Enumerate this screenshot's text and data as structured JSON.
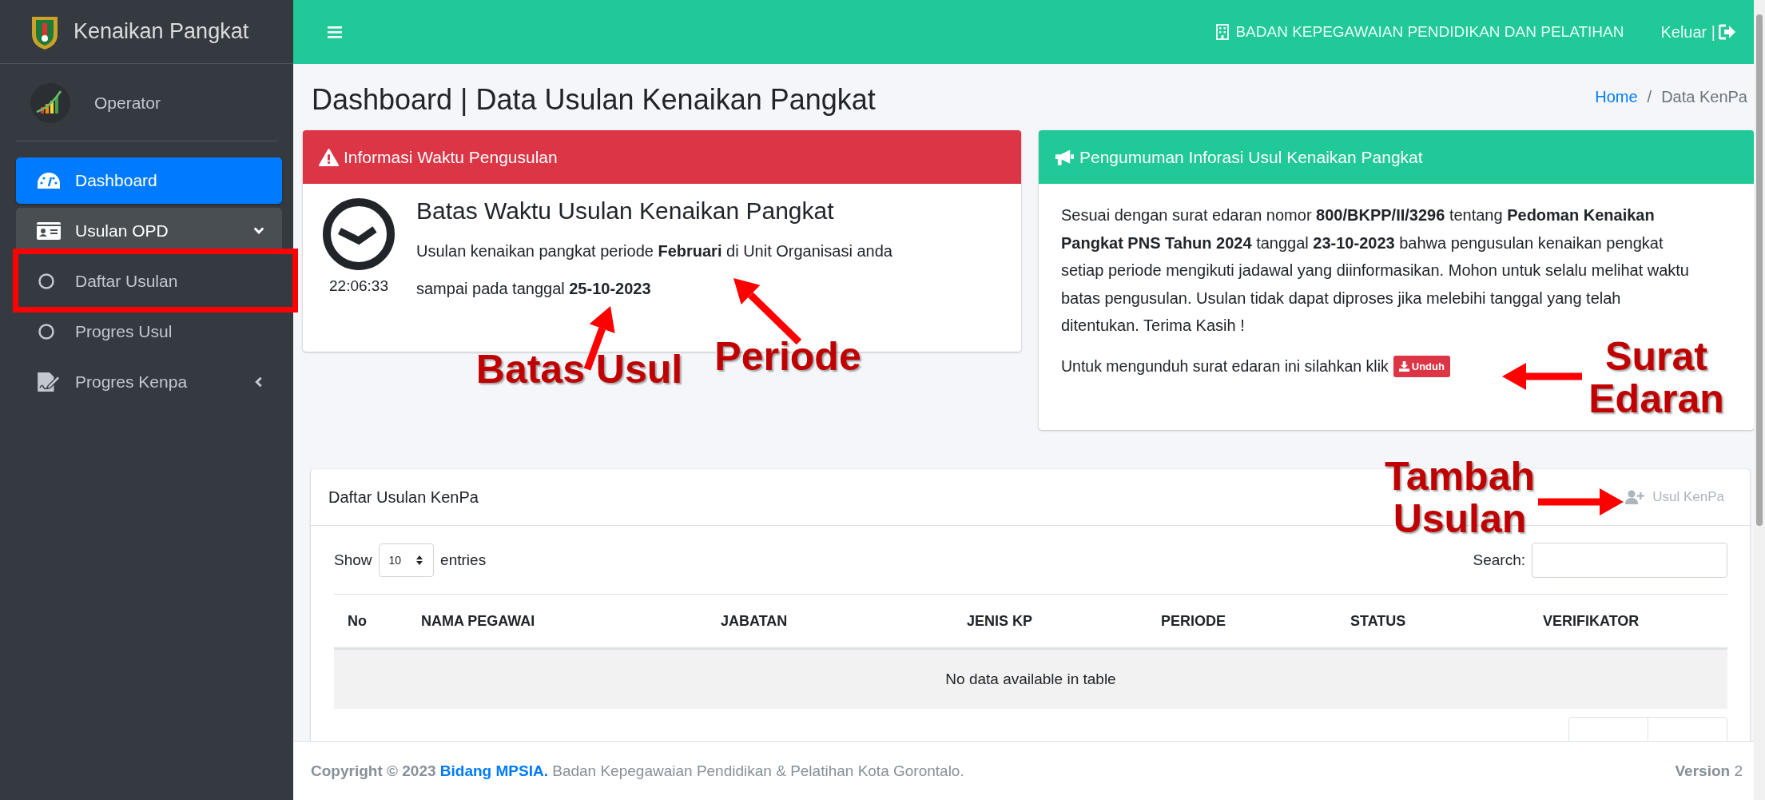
{
  "sidebar": {
    "brand": "Kenaikan Pangkat",
    "user": "Operator",
    "items": [
      {
        "label": "Dashboard",
        "selected": true
      },
      {
        "label": "Usulan OPD",
        "selected": false,
        "expanded": true,
        "children": [
          {
            "label": "Daftar Usulan",
            "selected": false,
            "highlighted": true
          },
          {
            "label": "Progres Usul",
            "selected": false,
            "highlighted": false
          }
        ]
      },
      {
        "label": "Progres Kenpa",
        "selected": false,
        "expanded": false
      }
    ]
  },
  "navbar": {
    "organization": "BADAN KEPEGAWAIAN PENDIDIKAN DAN PELATIHAN",
    "logout": "Keluar |"
  },
  "page": {
    "title": "Dashboard | Data Usulan Kenaikan Pangkat",
    "breadcrumb_separator": "/",
    "breadcrumb": [
      {
        "label": "Home",
        "selected": false
      },
      {
        "label": "Data KenPa",
        "selected": true
      }
    ]
  },
  "deadline_card": {
    "title": "Informasi Waktu Pengusulan",
    "clock_time": "22:06:33",
    "heading": "Batas Waktu Usulan Kenaikan Pangkat",
    "text": "Usulan kenaikan pangkat periode **Februari** di Unit Organisasi anda sampai pada tanggal **25-10-2023**"
  },
  "announcement_card": {
    "title": "Pengumuman Inforasi Usul Kenaikan Pangkat",
    "text": "Sesuai dengan surat edaran nomor **800/BKPP/II/3296** tentang **Pedoman Kenaikan Pangkat PNS Tahun 2024** tanggal **23-10-2023** bahwa pengusulan kenaikan pengkat setiap periode mengikuti jadawal yang diinformasikan. Mohon untuk selalu melihat waktu batas pengusulan. Usulan tidak dapat diproses jika melebihi tanggal yang telah ditentukan. Terima Kasih !",
    "download_prompt": "Untuk mengunduh surat edaran ini silahkan klik",
    "download_button": "Unduh"
  },
  "proposal_table": {
    "title": "Daftar Usulan KenPa",
    "add_button": "Usul KenPa",
    "show_label": "Show",
    "page_size": "10",
    "entries_label": "entries",
    "search_label": "Search:",
    "columns": [
      "No",
      "NAMA PEGAWAI",
      "JABATAN",
      "JENIS KP",
      "PERIODE",
      "STATUS",
      "VERIFIKATOR"
    ],
    "empty_message": "No data available in table"
  },
  "footer": {
    "copyright": "Copyright © 2023",
    "link": "Bidang MPSIA.",
    "text": "Badan Kepegawaian Pendidikan & Pelatihan Kota Gorontalo.",
    "version": "**Version** 2"
  },
  "callouts": [
    {
      "text": "Batas Usul"
    },
    {
      "text": "Periode"
    },
    {
      "text": "Surat Edaran"
    },
    {
      "text": "Tambah Usulan"
    }
  ]
}
